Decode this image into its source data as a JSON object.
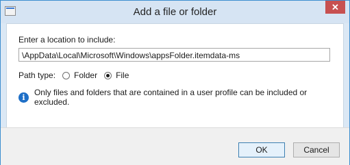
{
  "window": {
    "title": "Add a file or folder",
    "close_symbol": "✕"
  },
  "form": {
    "location_label": "Enter a location to include:",
    "path_value": "\\AppData\\Local\\Microsoft\\Windows\\appsFolder.itemdata-ms",
    "path_type_label": "Path type:",
    "options": [
      {
        "label": "Folder",
        "selected": false
      },
      {
        "label": "File",
        "selected": true
      }
    ],
    "info_icon": "i",
    "info_text": "Only files and folders that are contained in a user profile can be included or excluded."
  },
  "buttons": {
    "ok": "OK",
    "cancel": "Cancel"
  },
  "colors": {
    "titlebar": "#d6e4f3",
    "close": "#c75050",
    "info": "#1e6fc7"
  },
  "icons": {
    "app": "app-window-icon",
    "info": "info-icon"
  }
}
